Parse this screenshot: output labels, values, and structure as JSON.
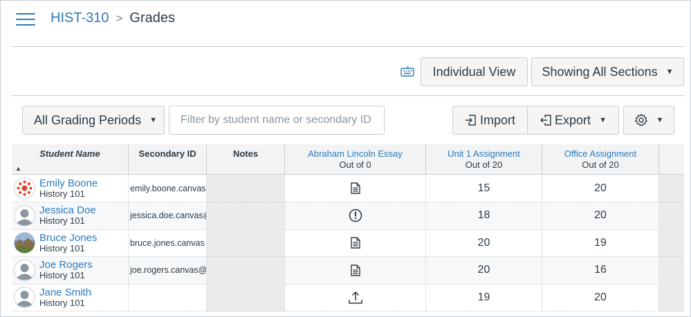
{
  "breadcrumb": {
    "course": "HIST-310",
    "separator": ">",
    "page": "Grades"
  },
  "toolbar": {
    "individual_view": "Individual View",
    "sections": "Showing All Sections",
    "grading_periods": "All Grading Periods",
    "search_placeholder": "Filter by student name or secondary ID",
    "import": "Import",
    "export": "Export"
  },
  "colors": {
    "link": "#2b7abc",
    "text": "#2d3b45",
    "border": "#c7cdd1",
    "header_bg": "#f2f3f4",
    "notes_bg": "#e9ebed"
  },
  "columns": {
    "student": "Student Name",
    "secondary_id": "Secondary ID",
    "notes": "Notes",
    "assignments": [
      {
        "name": "Abraham Lincoln Essay",
        "points": "Out of 0"
      },
      {
        "name": "Unit 1 Assignment",
        "points": "Out of 20"
      },
      {
        "name": "Office Assignment",
        "points": "Out of 20"
      }
    ]
  },
  "students": [
    {
      "name": "Emily Boone",
      "section": "History 101",
      "avatar": "canvas-logo-avatar",
      "secondary_id": "emily.boone.canvas",
      "essay_icon": "document-icon",
      "unit1": "15",
      "office": "20"
    },
    {
      "name": "Jessica Doe",
      "section": "History 101",
      "avatar": "default-avatar",
      "secondary_id": "jessica.doe.canvas@",
      "essay_icon": "warning-icon",
      "unit1": "18",
      "office": "20"
    },
    {
      "name": "Bruce Jones",
      "section": "History 101",
      "avatar": "photo-avatar",
      "secondary_id": "bruce.jones.canvas",
      "essay_icon": "document-icon",
      "unit1": "20",
      "office": "19"
    },
    {
      "name": "Joe Rogers",
      "section": "History 101",
      "avatar": "default-avatar",
      "secondary_id": "joe.rogers.canvas@",
      "essay_icon": "document-icon",
      "unit1": "20",
      "office": "16"
    },
    {
      "name": "Jane Smith",
      "section": "History 101",
      "avatar": "default-avatar",
      "secondary_id": "",
      "essay_icon": "upload-icon",
      "unit1": "19",
      "office": "20"
    }
  ]
}
